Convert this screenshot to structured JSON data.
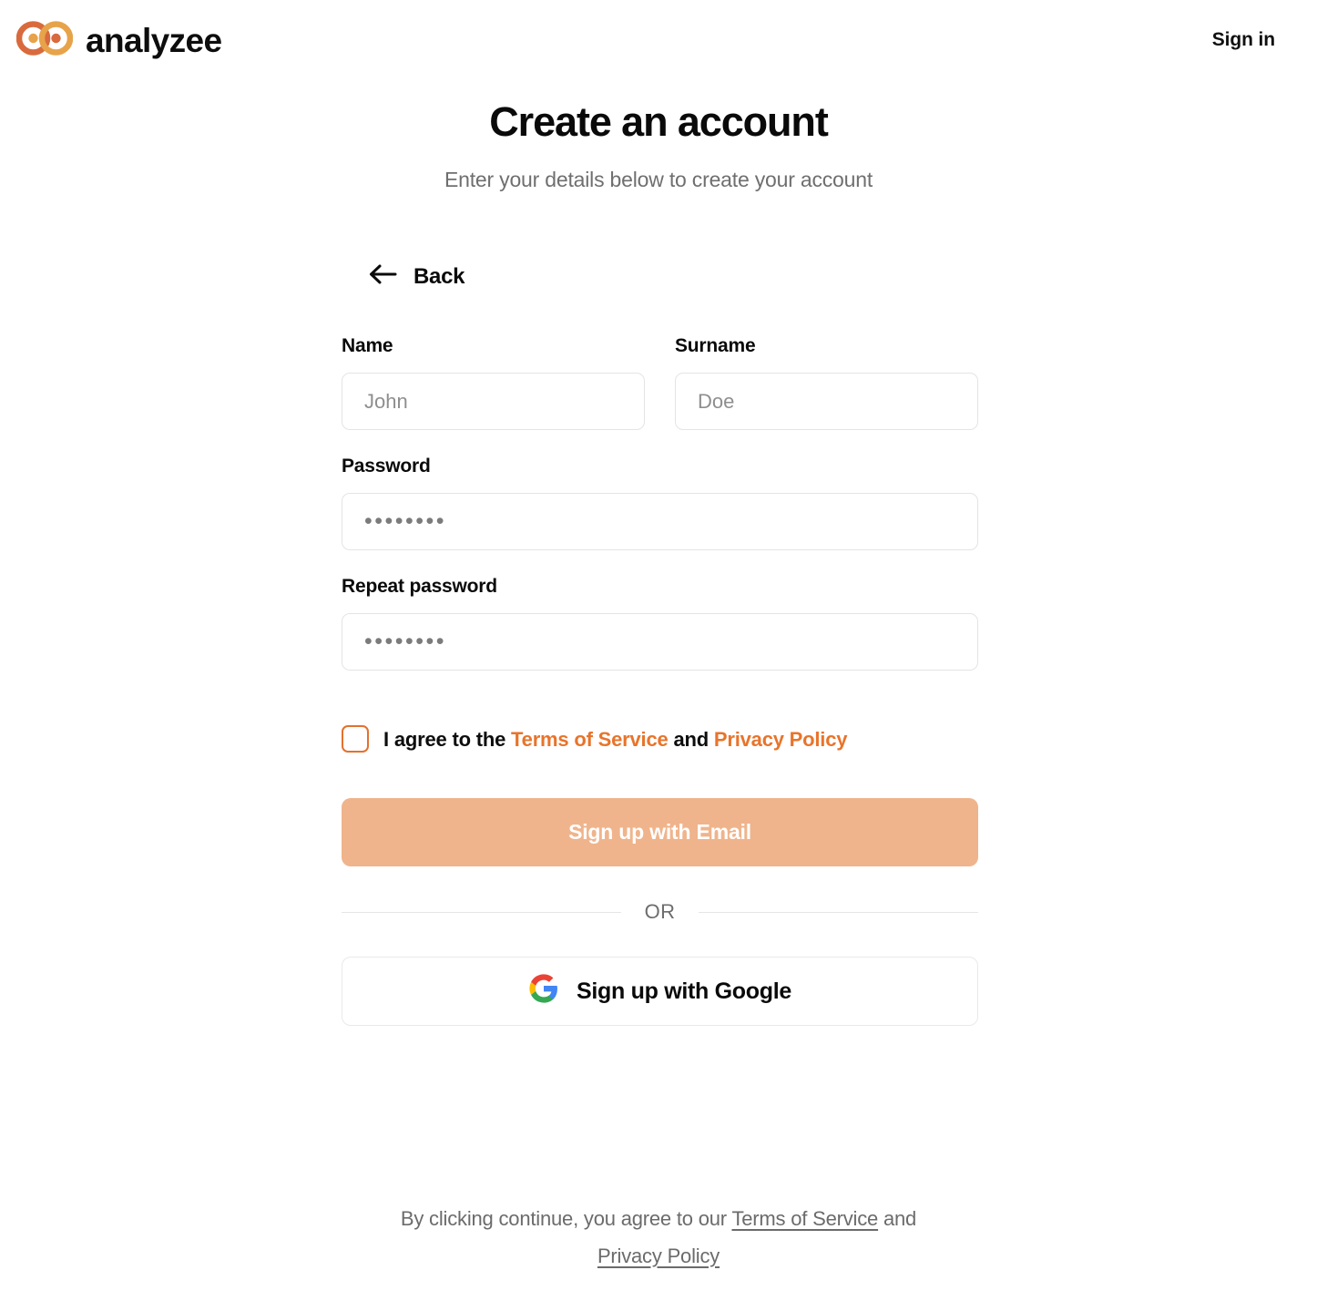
{
  "brand": {
    "name": "analyzee",
    "logo_icon": "infinity-rings-logo",
    "logo_color_left": "#d96a3d",
    "logo_color_right": "#e7a34a"
  },
  "header": {
    "signin_label": "Sign in"
  },
  "page": {
    "title": "Create an account",
    "subtitle": "Enter your details below to create your account"
  },
  "back": {
    "label": "Back",
    "icon": "arrow-left-icon"
  },
  "form": {
    "fields": [
      {
        "label": "Name",
        "placeholder": "John",
        "type": "text",
        "value": ""
      },
      {
        "label": "Surname",
        "placeholder": "Doe",
        "type": "text",
        "value": ""
      },
      {
        "label": "Password",
        "placeholder": "••••••••",
        "type": "password",
        "value": ""
      },
      {
        "label": "Repeat password",
        "placeholder": "••••••••",
        "type": "password",
        "value": ""
      }
    ],
    "consent": {
      "checked": false,
      "prefix": "I agree to the ",
      "terms_label": "Terms of Service",
      "middle": " and ",
      "privacy_label": "Privacy Policy",
      "link_color": "#e8742b",
      "checkbox_border_color": "#e3712e"
    },
    "submit": {
      "label": "Sign up with Email",
      "background": "#efb48c",
      "text_color": "#ffffff",
      "disabled": true
    },
    "divider_label": "OR",
    "google": {
      "label": "Sign up with Google",
      "icon": "google-g-icon",
      "colors": {
        "red": "#ea4335",
        "blue": "#4285f4",
        "green": "#34a853",
        "yellow": "#fbbc05"
      }
    }
  },
  "footer": {
    "prefix": "By clicking continue, you agree to our ",
    "terms_label": "Terms of Service",
    "middle": " and ",
    "privacy_label": "Privacy Policy"
  }
}
